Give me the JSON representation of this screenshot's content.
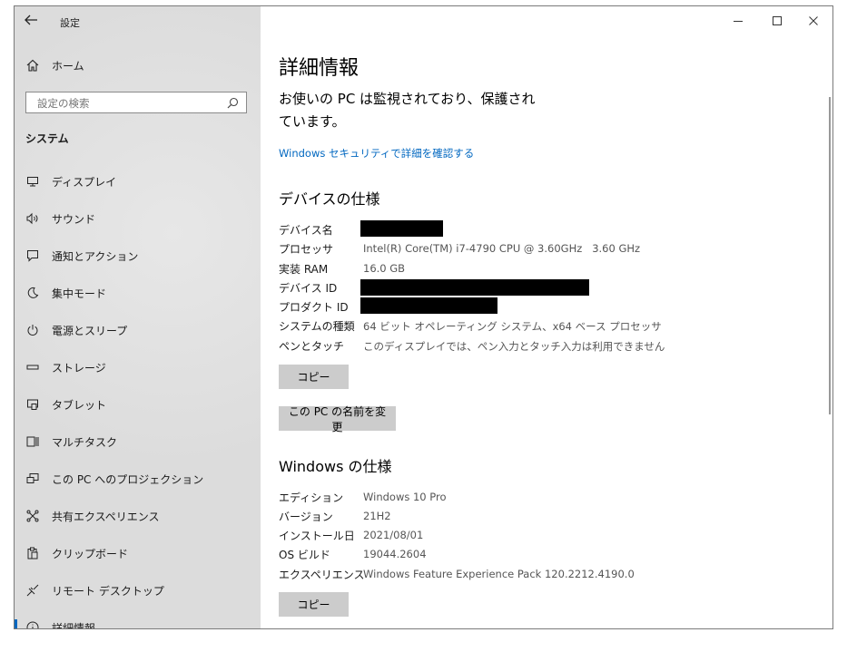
{
  "window": {
    "app_title": "設定",
    "back_icon": "back-arrow-icon",
    "controls": [
      "minimize-icon",
      "maximize-icon",
      "close-icon"
    ]
  },
  "sidebar": {
    "home_label": "ホーム",
    "search_placeholder": "設定の検索",
    "section_title": "システム",
    "items": [
      {
        "label": "ディスプレイ",
        "icon": "display-icon"
      },
      {
        "label": "サウンド",
        "icon": "speaker-icon"
      },
      {
        "label": "通知とアクション",
        "icon": "notification-icon"
      },
      {
        "label": "集中モード",
        "icon": "moon-icon"
      },
      {
        "label": "電源とスリープ",
        "icon": "power-icon"
      },
      {
        "label": "ストレージ",
        "icon": "storage-icon"
      },
      {
        "label": "タブレット",
        "icon": "tablet-icon"
      },
      {
        "label": "マルチタスク",
        "icon": "multitask-icon"
      },
      {
        "label": "この PC へのプロジェクション",
        "icon": "projection-icon"
      },
      {
        "label": "共有エクスペリエンス",
        "icon": "shared-experience-icon"
      },
      {
        "label": "クリップボード",
        "icon": "clipboard-icon"
      },
      {
        "label": "リモート デスクトップ",
        "icon": "remote-desktop-icon"
      },
      {
        "label": "詳細情報",
        "icon": "info-icon",
        "active": true
      }
    ],
    "accent_color": "#0067c0"
  },
  "main": {
    "page_title": "詳細情報",
    "protection_status": [
      "お使いの PC は監視されており、保護され",
      "ています。"
    ],
    "security_link": "Windows セキュリティで詳細を確認する",
    "device_spec": {
      "title": "デバイスの仕様",
      "rows": [
        {
          "label": "デバイス名",
          "value": "",
          "redacted": true
        },
        {
          "label": "プロセッサ",
          "value": "Intel(R) Core(TM) i7-4790 CPU @ 3.60GHz   3.60 GHz"
        },
        {
          "label": "実装 RAM",
          "value": "16.0 GB"
        },
        {
          "label": "デバイス ID",
          "value": "",
          "redacted": true
        },
        {
          "label": "プロダクト ID",
          "value": "",
          "redacted": true
        },
        {
          "label": "システムの種類",
          "value": "64 ビット オペレーティング システム、x64 ベース プロセッサ"
        },
        {
          "label": "ペンとタッチ",
          "value": "このディスプレイでは、ペン入力とタッチ入力は利用できません"
        }
      ],
      "copy_label": "コピー",
      "rename_label": "この PC の名前を変更"
    },
    "windows_spec": {
      "title": "Windows の仕様",
      "rows": [
        {
          "label": "エディション",
          "value": "Windows 10 Pro"
        },
        {
          "label": "バージョン",
          "value": "21H2"
        },
        {
          "label": "インストール日",
          "value": "2021/08/01"
        },
        {
          "label": "OS ビルド",
          "value": "19044.2604"
        },
        {
          "label": "エクスペリエンス",
          "value": "Windows Feature Experience Pack 120.2212.4190.0"
        }
      ],
      "copy_label": "コピー"
    },
    "link_color": "#0067c0"
  }
}
